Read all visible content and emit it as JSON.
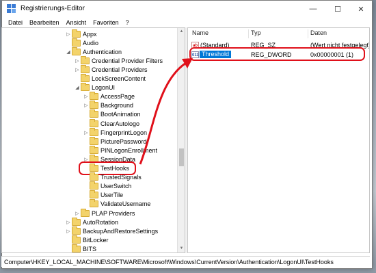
{
  "window": {
    "title": "Registrierungs-Editor",
    "minimize": "—",
    "maximize": "☐",
    "close": "✕",
    "accent": "#0078d7",
    "highlight": "#e0101a"
  },
  "menu": [
    "Datei",
    "Bearbeiten",
    "Ansicht",
    "Favoriten",
    "?"
  ],
  "tree": [
    {
      "label": "Appx",
      "toggle": "▷",
      "level": 0
    },
    {
      "label": "Audio",
      "toggle": "",
      "level": 0
    },
    {
      "label": "Authentication",
      "toggle": "◢",
      "level": 0
    },
    {
      "label": "Credential Provider Filters",
      "toggle": "▷",
      "level": 1
    },
    {
      "label": "Credential Providers",
      "toggle": "▷",
      "level": 1
    },
    {
      "label": "LockScreenContent",
      "toggle": "",
      "level": 1
    },
    {
      "label": "LogonUI",
      "toggle": "◢",
      "level": 1
    },
    {
      "label": "AccessPage",
      "toggle": "▷",
      "level": 2
    },
    {
      "label": "Background",
      "toggle": "▷",
      "level": 2
    },
    {
      "label": "BootAnimation",
      "toggle": "",
      "level": 2
    },
    {
      "label": "ClearAutologo",
      "toggle": "",
      "level": 2
    },
    {
      "label": "FingerprintLogon",
      "toggle": "▷",
      "level": 2
    },
    {
      "label": "PicturePassword",
      "toggle": "",
      "level": 2
    },
    {
      "label": "PINLogonEnrollment",
      "toggle": "",
      "level": 2
    },
    {
      "label": "SessionData",
      "toggle": "▷",
      "level": 2
    },
    {
      "label": "TestHooks",
      "toggle": "",
      "level": 2,
      "highlighted": true
    },
    {
      "label": "TrustedSignals",
      "toggle": "",
      "level": 2
    },
    {
      "label": "UserSwitch",
      "toggle": "",
      "level": 2
    },
    {
      "label": "UserTile",
      "toggle": "",
      "level": 2
    },
    {
      "label": "ValidateUsername",
      "toggle": "",
      "level": 2
    },
    {
      "label": "PLAP Providers",
      "toggle": "▷",
      "level": 1
    },
    {
      "label": "AutoRotation",
      "toggle": "▷",
      "level": 0
    },
    {
      "label": "BackupAndRestoreSettings",
      "toggle": "▷",
      "level": 0
    },
    {
      "label": "BitLocker",
      "toggle": "",
      "level": 0
    },
    {
      "label": "BITS",
      "toggle": "",
      "level": 0
    }
  ],
  "list": {
    "headers": {
      "name": "Name",
      "type": "Typ",
      "data": "Daten"
    },
    "rows": [
      {
        "icon": "ab",
        "name": "(Standard)",
        "type": "REG_SZ",
        "data": "(Wert nicht festgelegt)"
      },
      {
        "icon": "011",
        "name": "Threshold",
        "type": "REG_DWORD",
        "data": "0x00000001 (1)",
        "selected": true
      }
    ]
  },
  "statusbar": {
    "path": "Computer\\HKEY_LOCAL_MACHINE\\SOFTWARE\\Microsoft\\Windows\\CurrentVersion\\Authentication\\LogonUI\\TestHooks"
  }
}
